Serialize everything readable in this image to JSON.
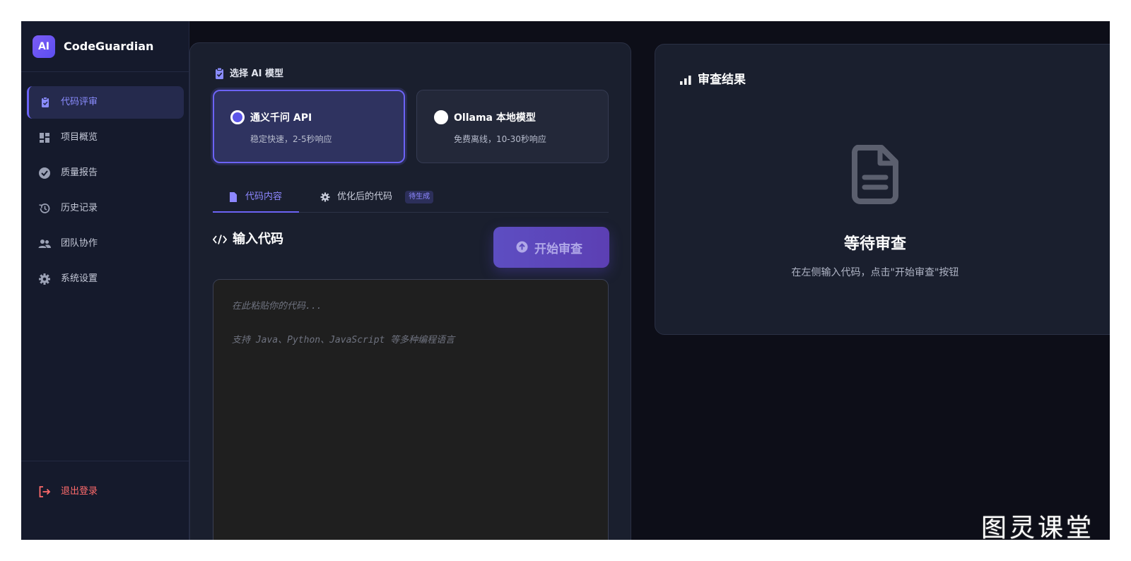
{
  "brand": {
    "logo": "AI",
    "name": "CodeGuardian"
  },
  "sidebar": {
    "items": [
      {
        "label": "代码评审",
        "icon": "clipboard-check-icon",
        "active": true
      },
      {
        "label": "项目概览",
        "icon": "dashboard-icon",
        "active": false
      },
      {
        "label": "质量报告",
        "icon": "check-circle-icon",
        "active": false
      },
      {
        "label": "历史记录",
        "icon": "history-icon",
        "active": false
      },
      {
        "label": "团队协作",
        "icon": "people-icon",
        "active": false
      },
      {
        "label": "系统设置",
        "icon": "gear-icon",
        "active": false
      }
    ],
    "logout": "退出登录"
  },
  "model_section": {
    "label": "选择 AI 模型",
    "models": [
      {
        "title": "通义千问 API",
        "desc": "稳定快速，2-5秒响应",
        "selected": true
      },
      {
        "title": "Ollama 本地模型",
        "desc": "免费离线，10-30秒响应",
        "selected": false
      }
    ]
  },
  "tabs": [
    {
      "label": "代码内容",
      "active": true
    },
    {
      "label": "优化后的代码",
      "badge": "待生成",
      "active": false
    }
  ],
  "editor": {
    "title": "输入代码",
    "start_button": "开始审查",
    "placeholder_line1": "在此粘贴你的代码...",
    "placeholder_line2": "支持 Java、Python、JavaScript 等多种编程语言"
  },
  "result": {
    "title": "审查结果",
    "wait_title": "等待审查",
    "wait_desc": "在左侧输入代码，点击\"开始审查\"按钮"
  },
  "watermark": "图灵课堂",
  "colors": {
    "accent": "#6c63f5",
    "danger": "#ff6b6b",
    "bg": "#0d0e18",
    "panel": "#1a1f2e"
  }
}
